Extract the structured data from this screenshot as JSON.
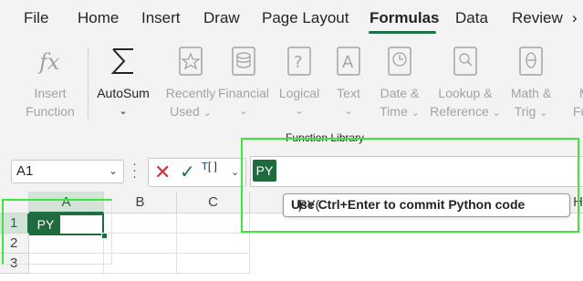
{
  "tabs": [
    "File",
    "Home",
    "Insert",
    "Draw",
    "Page Layout",
    "Formulas",
    "Data",
    "Review"
  ],
  "active_tab": "Formulas",
  "ribbon": {
    "insert_function": {
      "line1": "Insert",
      "line2": "Function",
      "icon": "fx-icon"
    },
    "autosum": {
      "label": "AutoSum",
      "icon": "sigma-icon"
    },
    "recently_used": {
      "line1": "Recently",
      "line2": "Used",
      "icon": "star-book-icon"
    },
    "financial": {
      "label": "Financial",
      "icon": "database-book-icon"
    },
    "logical": {
      "label": "Logical",
      "icon": "question-book-icon"
    },
    "text": {
      "label": "Text",
      "icon": "letter-a-book-icon"
    },
    "date_time": {
      "line1": "Date &",
      "line2": "Time",
      "icon": "clock-book-icon"
    },
    "lookup": {
      "line1": "Lookup &",
      "line2": "Reference",
      "icon": "magnifier-book-icon"
    },
    "math_trig": {
      "line1": "Math &",
      "line2": "Trig",
      "icon": "theta-book-icon"
    },
    "more_functions": {
      "line1": "M",
      "line2": "Fun"
    },
    "group_label": "Function Library"
  },
  "formula_bar": {
    "name_box": "A1",
    "insert_python_icon": "[ ]",
    "python_badge": "PY",
    "tooltip_prefix": "PY(",
    "tooltip_bold": "Use Ctrl+Enter to commit Python code",
    "tooltip_suffix": ")"
  },
  "grid": {
    "columns": [
      "A",
      "B",
      "C"
    ],
    "rows": [
      "1",
      "2",
      "3"
    ],
    "active_cell_badge": "PY",
    "partial_col": "H"
  },
  "colors": {
    "accent": "#1e6b3e",
    "highlight": "#3ee63e",
    "cancel": "#d13438",
    "enter": "#107c41"
  }
}
